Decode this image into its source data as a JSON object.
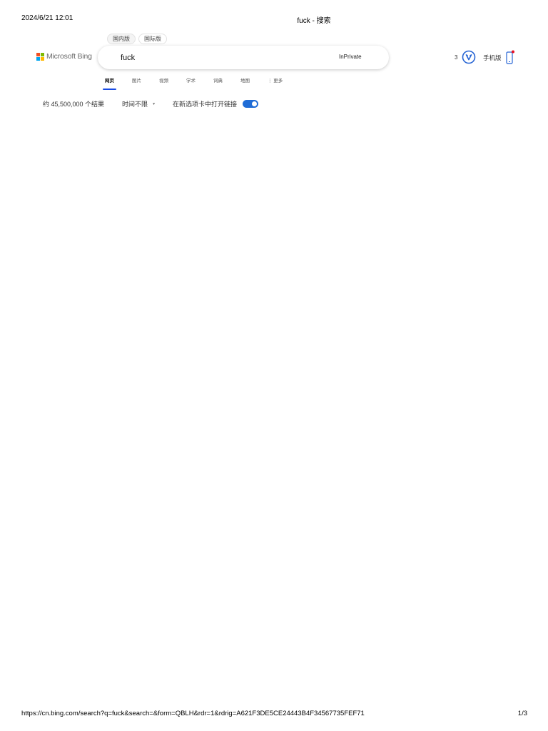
{
  "print_header": {
    "date": "2024/6/21 12:01",
    "title": "fuck - 搜索"
  },
  "print_footer": {
    "url": "https://cn.bing.com/search?q=fuck&search=&form=QBLH&rdr=1&rdrig=A621F3DE5CE24443B4F34567735FEF71",
    "page": "1/3"
  },
  "brand": {
    "name": "Microsoft Bing"
  },
  "region": {
    "domestic": "国内版",
    "international": "国际版"
  },
  "search": {
    "query": "fuck",
    "inprivate_label": "InPrivate"
  },
  "header": {
    "rewards_count": "3",
    "mobile_label": "手机版"
  },
  "tabs": [
    {
      "label": "网页",
      "active": true
    },
    {
      "label": "图片"
    },
    {
      "label": "视频"
    },
    {
      "label": "学术"
    },
    {
      "label": "词典"
    },
    {
      "label": "地图"
    },
    {
      "label": "⋮ 更多"
    }
  ],
  "results_bar": {
    "count": "约 45,500,000 个结果",
    "time_filter": "时间不限",
    "open_new_tab_label": "在新选项卡中打开链接",
    "open_new_tab_enabled": true
  },
  "colors": {
    "accent": "#174ae4",
    "toggle": "#1f6cd6",
    "notification": "#e81123"
  },
  "icons": {
    "rewards": "rewards-icon",
    "mobile": "mobile-phone-icon",
    "dropdown": "caret-down-icon"
  }
}
